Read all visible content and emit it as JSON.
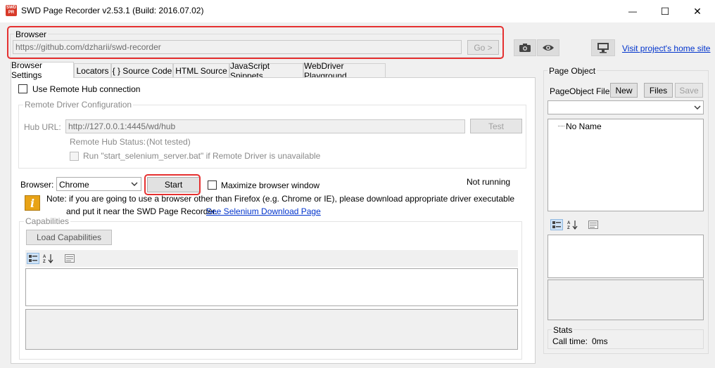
{
  "window": {
    "title": "SWD Page Recorder v2.53.1 (Build: 2016.07.02)",
    "logo_text": "SWD PR",
    "minimize_glyph": "—",
    "maximize_glyph": "☐",
    "close_glyph": "✕"
  },
  "browser_bar": {
    "group_label": "Browser",
    "url_value": "https://github.com/dzharii/swd-recorder",
    "go_label": "Go >",
    "visit_link": "Visit project's home site"
  },
  "tabs": [
    {
      "label": "Browser Settings"
    },
    {
      "label": "Locators"
    },
    {
      "label": "{ } Source Code"
    },
    {
      "label": "HTML Source"
    },
    {
      "label": "JavaScript Snippets"
    },
    {
      "label": "WebDriver Playground"
    }
  ],
  "settings": {
    "use_remote_hub_label": "Use Remote Hub connection",
    "remote_group_label": "Remote Driver Configuration",
    "hub_url_label": "Hub URL:",
    "hub_url_value": "http://127.0.0.1:4445/wd/hub",
    "test_label": "Test",
    "hub_status_label": "Remote Hub Status:",
    "hub_status_value": "(Not tested)",
    "run_selenium_label": "Run \"start_selenium_server.bat\" if Remote Driver is unavailable",
    "browser_label": "Browser:",
    "browser_value": "Chrome",
    "start_label": "Start",
    "maximize_label": "Maximize browser window",
    "status_text": "Not running",
    "note_line1": "Note: if you are going to use a browser other than Firefox (e.g. Chrome or IE), please download appropriate driver executable",
    "note_line2": "and put it near the SWD Page Recorder.",
    "download_link": "See Selenium Download Page",
    "capabilities_label": "Capabilities",
    "load_capabilities_label": "Load Capabilities"
  },
  "page_object": {
    "group_label": "Page Object",
    "file_label": "PageObject File:",
    "new_label": "New",
    "files_label": "Files",
    "save_label": "Save",
    "tree_item": "No Name",
    "stats_label": "Stats",
    "call_time_label": "Call time:",
    "call_time_value": "0ms"
  },
  "colors": {
    "highlight": "#e53030",
    "link": "#0033cc",
    "window_bg": "#f0f0f0"
  }
}
